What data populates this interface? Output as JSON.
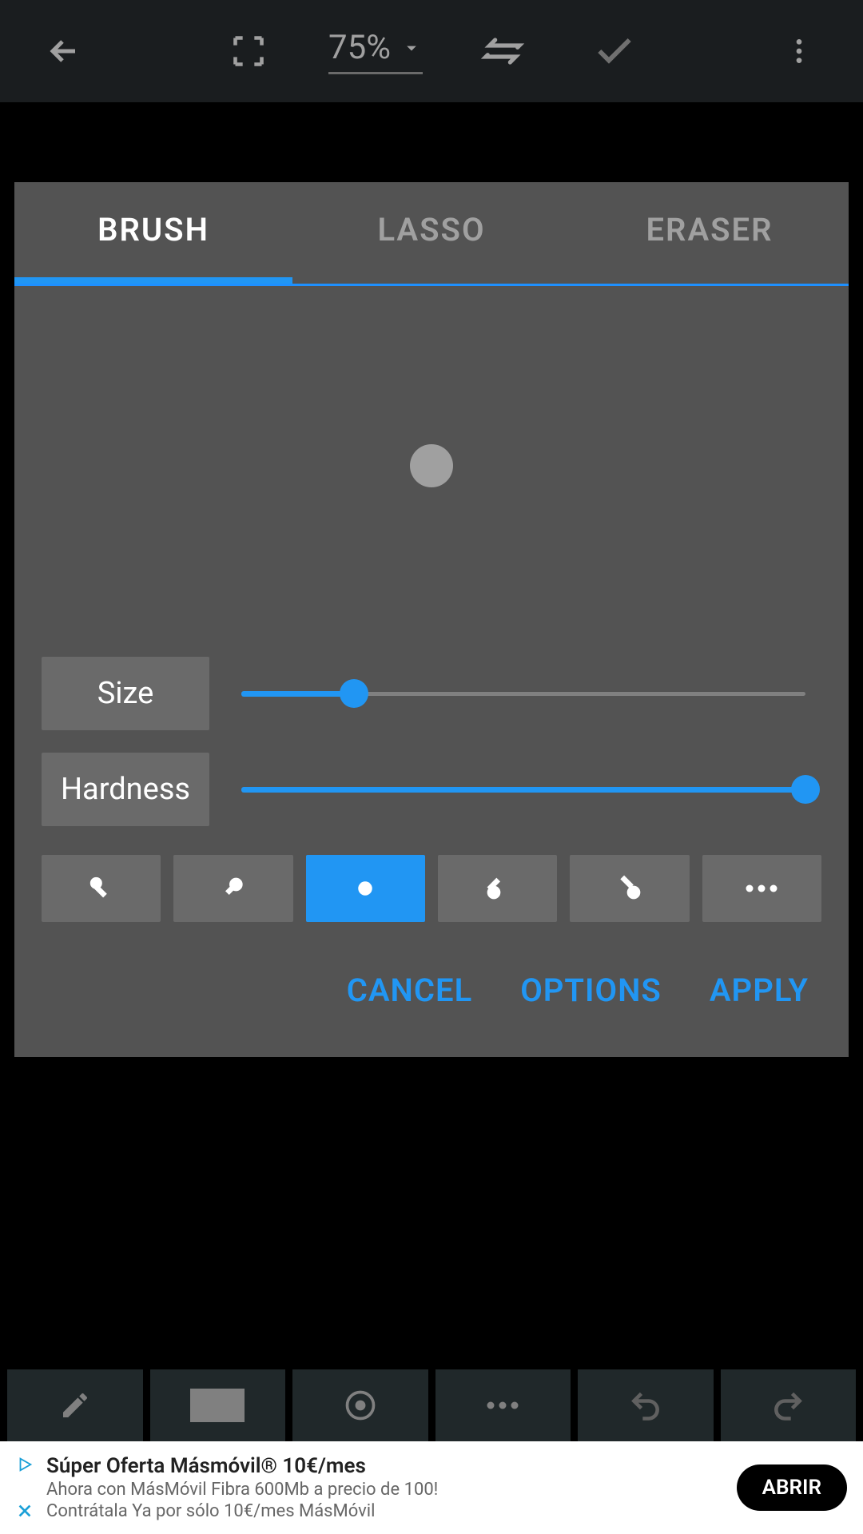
{
  "topbar": {
    "zoom": "75%"
  },
  "tabs": [
    {
      "label": "BRUSH",
      "active": true
    },
    {
      "label": "LASSO",
      "active": false
    },
    {
      "label": "ERASER",
      "active": false
    }
  ],
  "sliders": {
    "size": {
      "label": "Size",
      "value": 20
    },
    "hardness": {
      "label": "Hardness",
      "value": 100
    }
  },
  "shapes": {
    "active_index": 2
  },
  "actions": {
    "cancel": "CANCEL",
    "options": "OPTIONS",
    "apply": "APPLY"
  },
  "ad": {
    "title": "Súper Oferta Másmóvil® 10€/mes",
    "line1": "Ahora con MásMóvil Fibra 600Mb a precio de 100!",
    "line2": "Contrátala Ya por sólo 10€/mes MásMóvil",
    "cta": "ABRIR"
  },
  "colors": {
    "accent": "#2196f3"
  }
}
